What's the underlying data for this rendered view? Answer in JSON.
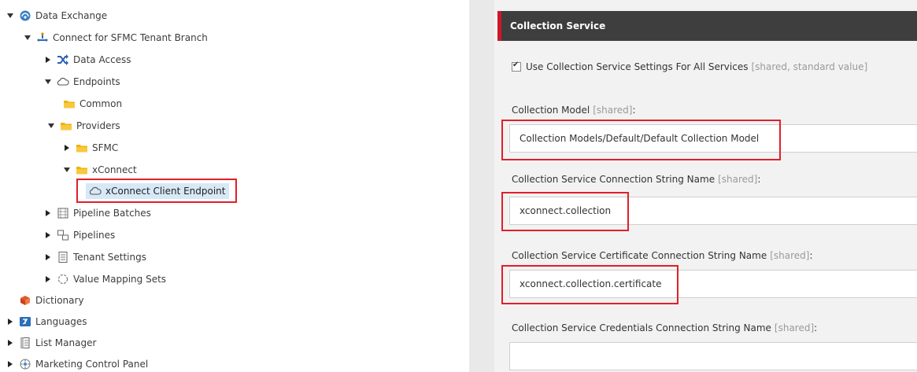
{
  "tree": {
    "items": [
      {
        "label": "Data Exchange",
        "icon": "data-exchange-icon",
        "expanded": true
      },
      {
        "label": "Connect for SFMC Tenant Branch",
        "icon": "tenant-branch-icon",
        "expanded": true
      },
      {
        "label": "Data Access",
        "icon": "shuffle-icon",
        "expanded": false
      },
      {
        "label": "Endpoints",
        "icon": "cloud-icon",
        "expanded": true
      },
      {
        "label": "Common",
        "icon": "folder-icon"
      },
      {
        "label": "Providers",
        "icon": "folder-icon",
        "expanded": true
      },
      {
        "label": "SFMC",
        "icon": "folder-icon",
        "expanded": false
      },
      {
        "label": "xConnect",
        "icon": "folder-icon",
        "expanded": true
      },
      {
        "label": "xConnect Client Endpoint",
        "icon": "cloud-icon",
        "selected": true
      },
      {
        "label": "Pipeline Batches",
        "icon": "pipeline-batches-icon",
        "expanded": false
      },
      {
        "label": "Pipelines",
        "icon": "pipelines-icon",
        "expanded": false
      },
      {
        "label": "Tenant Settings",
        "icon": "document-icon",
        "expanded": false
      },
      {
        "label": "Value Mapping Sets",
        "icon": "value-mapping-icon",
        "expanded": false
      },
      {
        "label": "Dictionary",
        "icon": "dictionary-icon"
      },
      {
        "label": "Languages",
        "icon": "languages-icon",
        "expanded": false
      },
      {
        "label": "List Manager",
        "icon": "list-manager-icon",
        "expanded": false
      },
      {
        "label": "Marketing Control Panel",
        "icon": "marketing-icon",
        "expanded": false
      }
    ]
  },
  "section": {
    "title": "Collection Service",
    "checkbox_label": "Use Collection Service Settings For All Services",
    "checkbox_meta": "[shared, standard value]",
    "checkbox_checked": true
  },
  "fields": [
    {
      "label": "Collection Model",
      "meta": "[shared]",
      "suffix": ":",
      "value": "Collection Models/Default/Default Collection Model"
    },
    {
      "label": "Collection Service Connection String Name",
      "meta": "[shared]",
      "suffix": ":",
      "value": "xconnect.collection"
    },
    {
      "label": "Collection Service Certificate Connection String Name",
      "meta": "[shared]",
      "suffix": ":",
      "value": "xconnect.collection.certificate"
    },
    {
      "label": "Collection Service Credentials Connection String Name",
      "meta": "[shared]",
      "suffix": ":",
      "value": ""
    }
  ],
  "colors": {
    "accent": "#d0162a",
    "highlight": "#e0202a",
    "header_bg": "#3e3e3e",
    "selection": "#d7e8f6",
    "folder": "#f0b400"
  }
}
